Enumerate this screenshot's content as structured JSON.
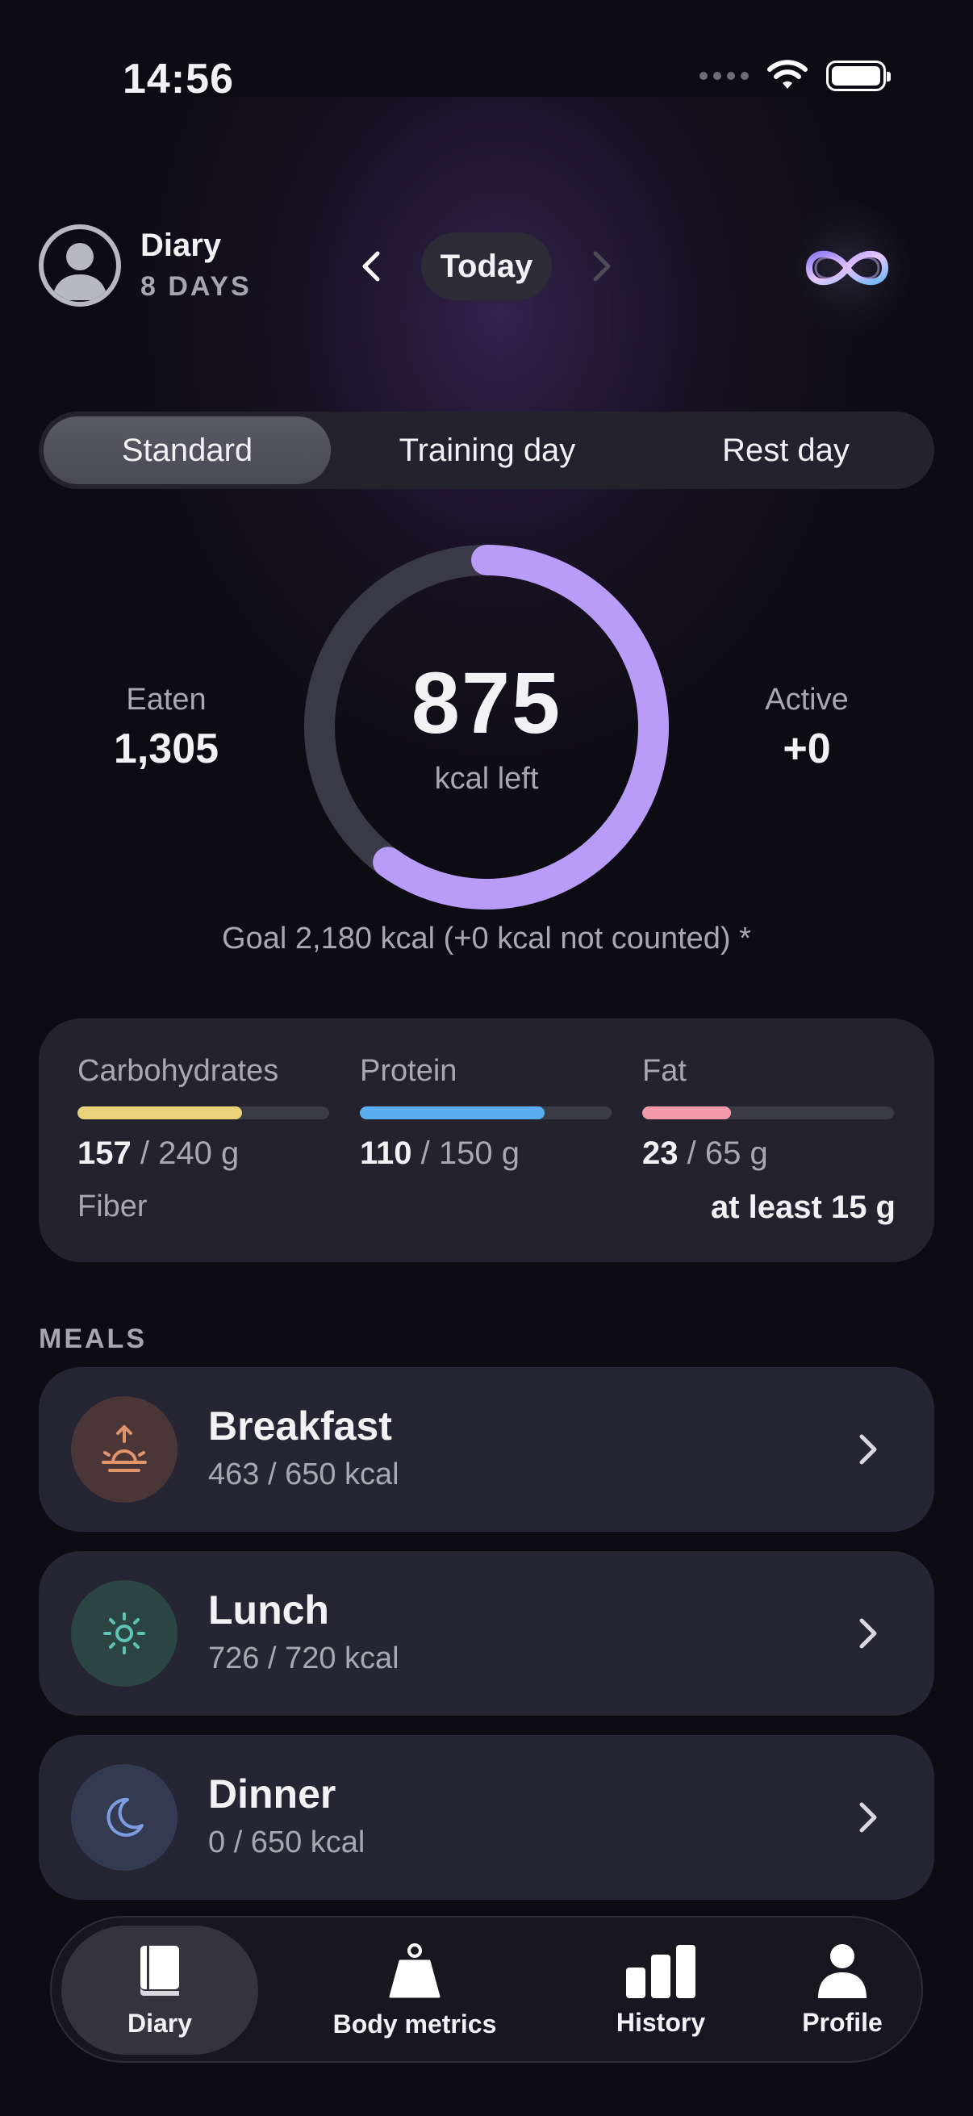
{
  "status_bar": {
    "time": "14:56"
  },
  "header": {
    "title": "Diary",
    "streak": "8 DAYS",
    "date_label": "Today"
  },
  "day_types": {
    "items": [
      "Standard",
      "Training day",
      "Rest day"
    ],
    "selected": "Standard"
  },
  "calories": {
    "eaten_label": "Eaten",
    "eaten_value": "1,305",
    "left_value": "875",
    "left_label": "kcal left",
    "active_label": "Active",
    "active_value": "+0",
    "goal_text": "Goal 2,180 kcal (+0 kcal not counted) *",
    "progress_fraction": 0.6
  },
  "macros": [
    {
      "name": "Carbohydrates",
      "current": "157",
      "target": " / 240 g",
      "fraction": 0.654,
      "color": "#e9d27a"
    },
    {
      "name": "Protein",
      "current": "110",
      "target": " / 150 g",
      "fraction": 0.733,
      "color": "#5aaef0"
    },
    {
      "name": "Fat",
      "current": "23",
      "target": " / 65 g",
      "fraction": 0.354,
      "color": "#f29aaa"
    }
  ],
  "fiber": {
    "label": "Fiber",
    "value": "at least 15 g"
  },
  "meals": {
    "header": "MEALS",
    "items": [
      {
        "name": "Breakfast",
        "kcal": "463 / 650 kcal",
        "icon": "sunrise-icon"
      },
      {
        "name": "Lunch",
        "kcal": "726 / 720 kcal",
        "icon": "sun-icon"
      },
      {
        "name": "Dinner",
        "kcal": "0 / 650 kcal",
        "icon": "moon-icon"
      }
    ]
  },
  "tabbar": {
    "items": [
      {
        "label": "Diary",
        "icon": "book-icon"
      },
      {
        "label": "Body metrics",
        "icon": "scale-icon"
      },
      {
        "label": "History",
        "icon": "bar-chart-icon"
      },
      {
        "label": "Profile",
        "icon": "person-icon"
      }
    ],
    "selected": "Diary"
  },
  "colors": {
    "accent_ring": "#b89cf7",
    "ring_track": "#3a3948",
    "background": "#0d0c12"
  }
}
